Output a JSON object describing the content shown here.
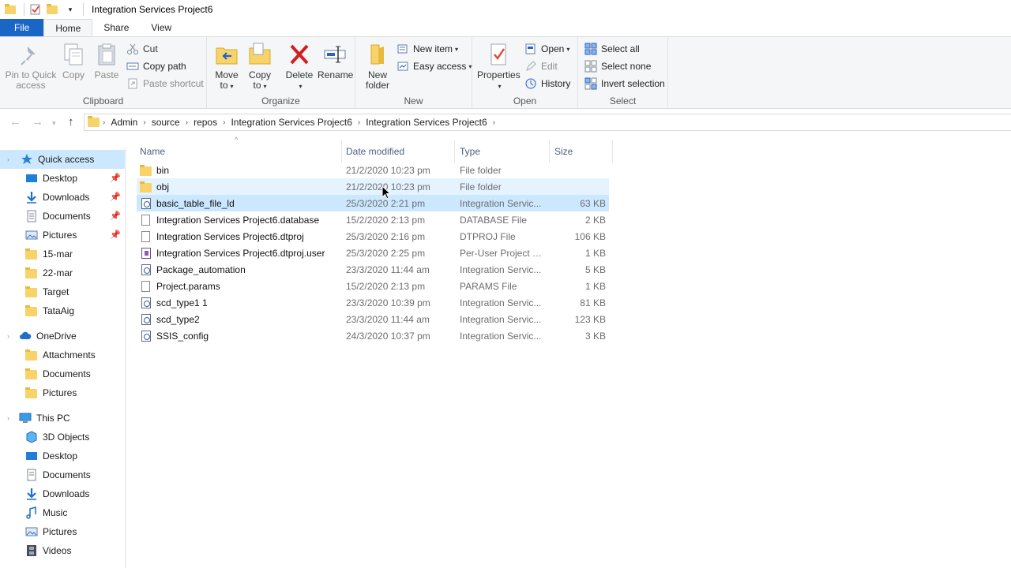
{
  "window": {
    "title": "Integration Services Project6"
  },
  "ribbon_tabs": [
    "File",
    "Home",
    "Share",
    "View"
  ],
  "ribbon": {
    "clipboard": {
      "label": "Clipboard",
      "pin": "Pin to Quick access",
      "pin_line1": "Pin to Quick",
      "pin_line2": "access",
      "copy": "Copy",
      "paste": "Paste",
      "cut": "Cut",
      "copy_path": "Copy path",
      "paste_shortcut": "Paste shortcut"
    },
    "organize": {
      "label": "Organize",
      "move_to_1": "Move",
      "move_to_2": "to",
      "copy_to_1": "Copy",
      "copy_to_2": "to",
      "delete": "Delete",
      "rename": "Rename"
    },
    "new": {
      "label": "New",
      "new_folder_1": "New",
      "new_folder_2": "folder",
      "new_item": "New item",
      "easy_access": "Easy access"
    },
    "open": {
      "label": "Open",
      "properties": "Properties",
      "open": "Open",
      "edit": "Edit",
      "history": "History"
    },
    "select": {
      "label": "Select",
      "select_all": "Select all",
      "select_none": "Select none",
      "invert_selection": "Invert selection"
    }
  },
  "breadcrumb": [
    "Admin",
    "source",
    "repos",
    "Integration Services Project6",
    "Integration Services Project6"
  ],
  "nav_pane": {
    "quick_access": "Quick access",
    "quick_items": [
      "Desktop",
      "Downloads",
      "Documents",
      "Pictures",
      "15-mar",
      "22-mar",
      "Target",
      "TataAig"
    ],
    "onedrive": "OneDrive",
    "onedrive_items": [
      "Attachments",
      "Documents",
      "Pictures"
    ],
    "this_pc": "This PC",
    "pc_items": [
      "3D Objects",
      "Desktop",
      "Documents",
      "Downloads",
      "Music",
      "Pictures",
      "Videos"
    ]
  },
  "columns": {
    "name": "Name",
    "date": "Date modified",
    "type": "Type",
    "size": "Size"
  },
  "files": [
    {
      "name": "bin",
      "date": "21/2/2020 10:23 pm",
      "type": "File folder",
      "size": "",
      "icon": "folder-icon"
    },
    {
      "name": "obj",
      "date": "21/2/2020 10:23 pm",
      "type": "File folder",
      "size": "",
      "icon": "folder-icon"
    },
    {
      "name": "basic_table_file_ld",
      "date": "25/3/2020 2:21 pm",
      "type": "Integration Servic...",
      "size": "63 KB",
      "icon": "package-icon"
    },
    {
      "name": "Integration Services Project6.database",
      "date": "15/2/2020 2:13 pm",
      "type": "DATABASE File",
      "size": "2 KB",
      "icon": "file-icon"
    },
    {
      "name": "Integration Services Project6.dtproj",
      "date": "25/3/2020 2:16 pm",
      "type": "DTPROJ File",
      "size": "106 KB",
      "icon": "file-icon"
    },
    {
      "name": "Integration Services Project6.dtproj.user",
      "date": "25/3/2020 2:25 pm",
      "type": "Per-User Project O...",
      "size": "1 KB",
      "icon": "user-file-icon"
    },
    {
      "name": "Package_automation",
      "date": "23/3/2020 11:44 am",
      "type": "Integration Servic...",
      "size": "5 KB",
      "icon": "package-icon"
    },
    {
      "name": "Project.params",
      "date": "15/2/2020 2:13 pm",
      "type": "PARAMS File",
      "size": "1 KB",
      "icon": "file-icon"
    },
    {
      "name": "scd_type1 1",
      "date": "23/3/2020 10:39 pm",
      "type": "Integration Servic...",
      "size": "81 KB",
      "icon": "package-icon"
    },
    {
      "name": "scd_type2",
      "date": "23/3/2020 11:44 am",
      "type": "Integration Servic...",
      "size": "123 KB",
      "icon": "package-icon"
    },
    {
      "name": "SSIS_config",
      "date": "24/3/2020 10:37 pm",
      "type": "Integration Servic...",
      "size": "3 KB",
      "icon": "package-icon"
    }
  ],
  "colors": {
    "file_tab": "#1a66c7",
    "selection": "#cce8ff",
    "hover": "#e5f3ff",
    "folder": "#f7d36a",
    "delete_red": "#d11f1f"
  }
}
